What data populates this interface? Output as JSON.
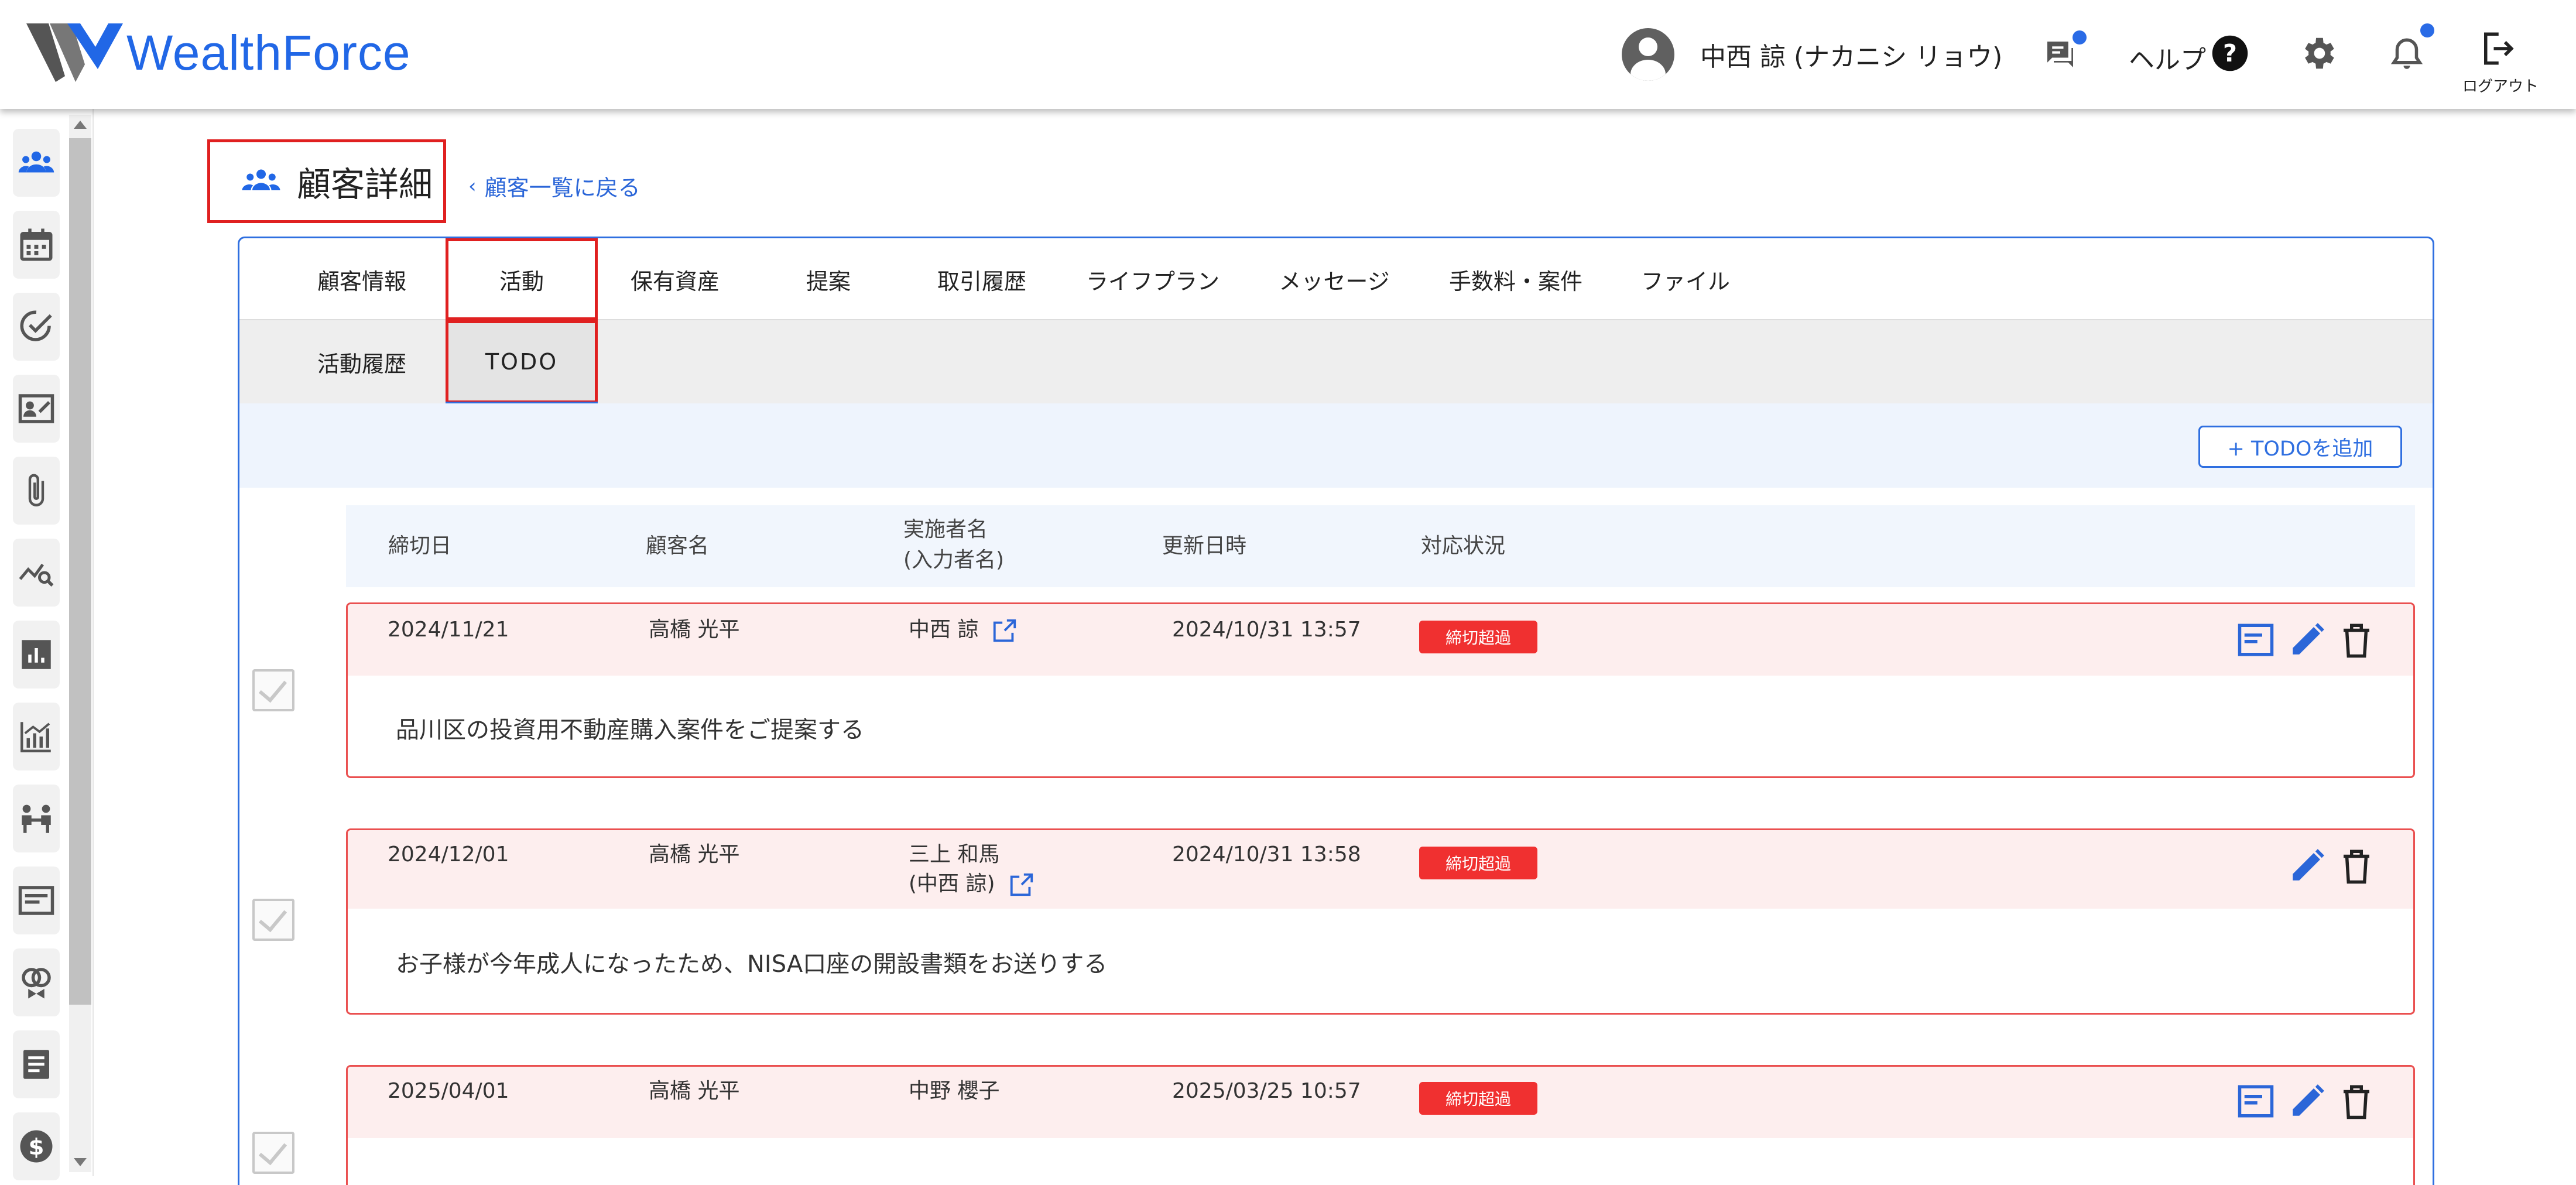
{
  "header": {
    "logo_text": "WealthForce",
    "user_name": "中西 諒 (ナカニシ リョウ)",
    "help_label": "ヘルプ",
    "logout_label": "ログアウト",
    "accent_color": "#2167e6",
    "notification_dot_color": "#2a6be6"
  },
  "sidebar": {
    "items": [
      {
        "icon": "customers-icon"
      },
      {
        "icon": "calendar-icon"
      },
      {
        "icon": "check-circle-icon"
      },
      {
        "icon": "contact-card-icon"
      },
      {
        "icon": "paperclip-icon"
      },
      {
        "icon": "chart-search-icon"
      },
      {
        "icon": "bar-report-icon"
      },
      {
        "icon": "analytics-icon"
      },
      {
        "icon": "meeting-icon"
      },
      {
        "icon": "message-card-icon"
      },
      {
        "icon": "rings-icon"
      },
      {
        "icon": "document-icon"
      },
      {
        "icon": "dollar-icon"
      }
    ]
  },
  "page": {
    "title": "顧客詳細",
    "back_link": "顧客一覧に戻る"
  },
  "tabs": [
    "顧客情報",
    "活動",
    "保有資産",
    "提案",
    "取引履歴",
    "ライフプラン",
    "メッセージ",
    "手数料・案件",
    "ファイル"
  ],
  "active_tab": "活動",
  "subtabs": [
    "活動履歴",
    "TODO"
  ],
  "active_subtab": "TODO",
  "toolbar": {
    "add_button": "+ TODOを追加"
  },
  "table": {
    "headers": {
      "deadline": "締切日",
      "customer": "顧客名",
      "assignee": "実施者名",
      "assignee_sub": "(入力者名)",
      "updated": "更新日時",
      "status": "対応状況"
    },
    "rows": [
      {
        "deadline": "2024/11/21",
        "customer": "高橋 光平",
        "assignee": "中西 諒",
        "assignee_sub": "",
        "updated": "2024/10/31 13:57",
        "status": "締切超過",
        "text": "品川区の投資用不動産購入案件をご提案する"
      },
      {
        "deadline": "2024/12/01",
        "customer": "高橋 光平",
        "assignee": "三上 和馬",
        "assignee_sub": "(中西 諒)",
        "updated": "2024/10/31 13:58",
        "status": "締切超過",
        "text": "お子様が今年成人になったため、NISA口座の開設書類をお送りする"
      },
      {
        "deadline": "2025/04/01",
        "customer": "高橋 光平",
        "assignee": "中野 櫻子",
        "assignee_sub": "",
        "updated": "2025/03/25 10:57",
        "status": "締切超過",
        "text": ""
      }
    ]
  },
  "colors": {
    "overdue_badge": "#f03030",
    "row_border": "#ea5050",
    "row_header_bg": "#fdeeee",
    "highlight_box": "#e02020"
  }
}
